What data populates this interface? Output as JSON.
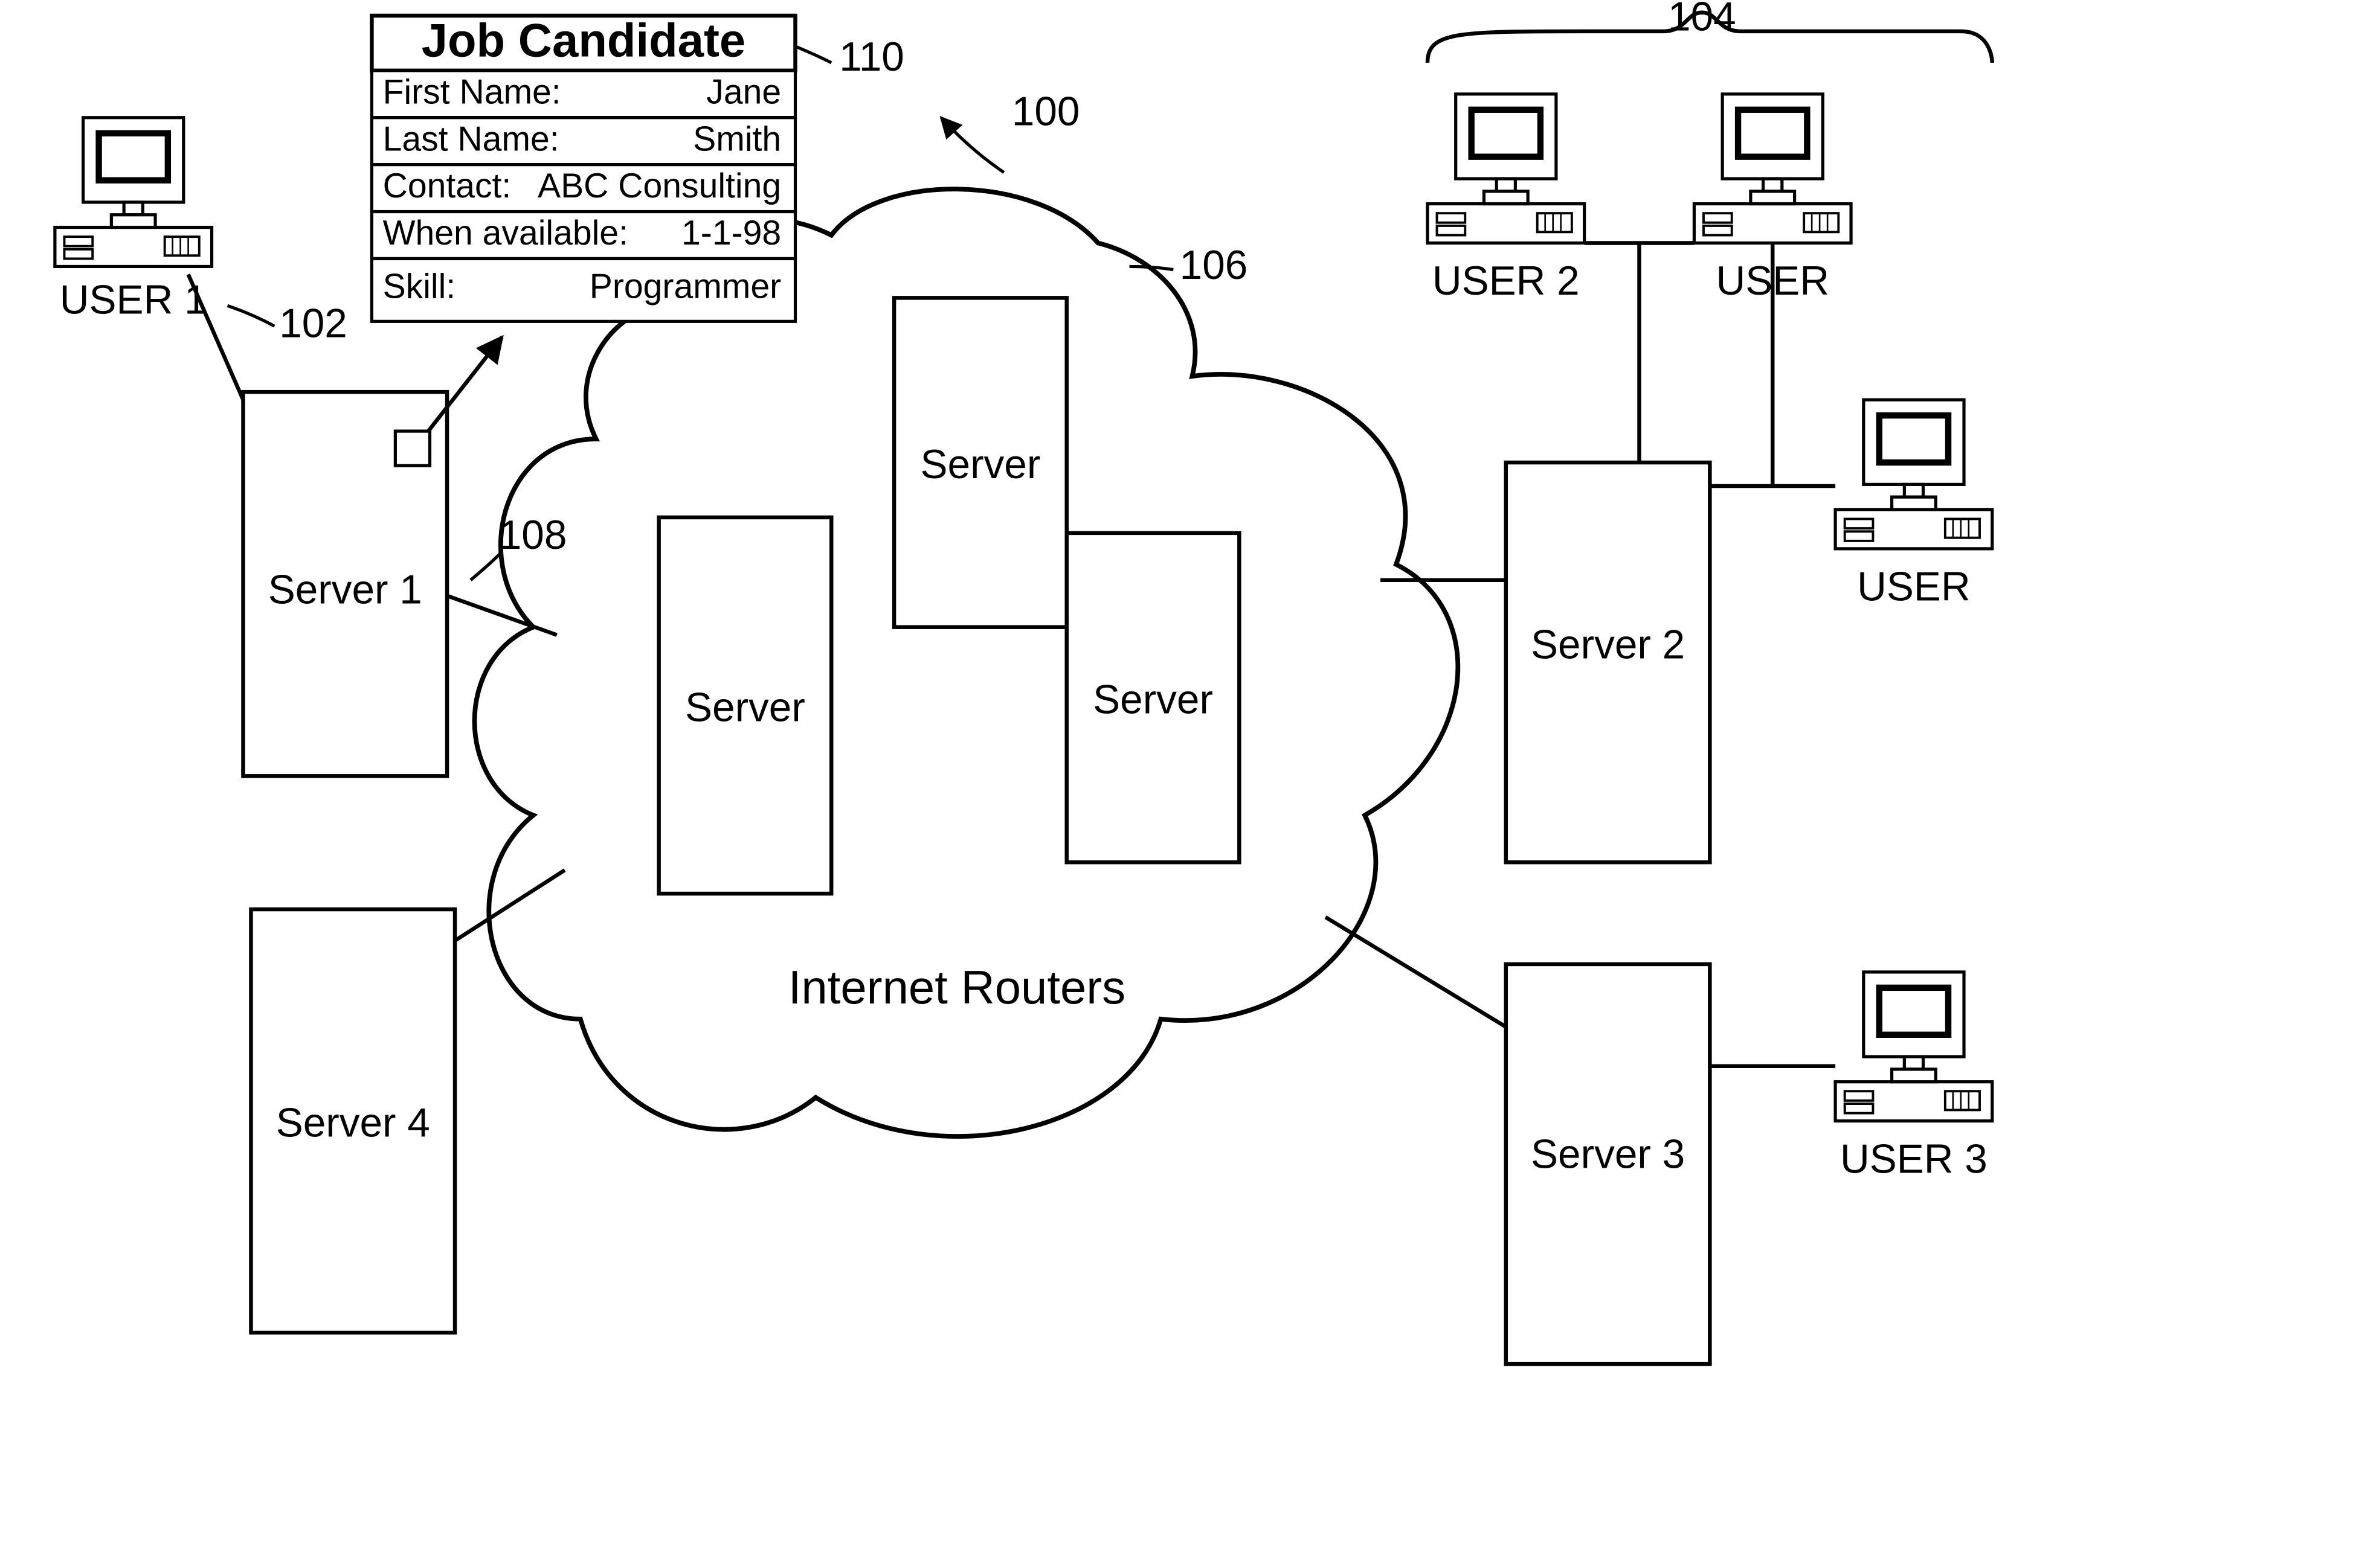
{
  "figure_refs": {
    "main": "100",
    "user1": "102",
    "user_group": "104",
    "cloud": "106",
    "link": "108",
    "card": "110"
  },
  "card": {
    "title": "Job Candidate",
    "rows": [
      {
        "label": "First Name:",
        "value": "Jane"
      },
      {
        "label": "Last Name:",
        "value": "Smith"
      },
      {
        "label": "Contact:",
        "value": "ABC Consulting"
      },
      {
        "label": "When available:",
        "value": "1-1-98"
      },
      {
        "label": "Skill:",
        "value": "Programmer"
      }
    ]
  },
  "cloud": {
    "label": "Internet Routers",
    "nodes": [
      "Server",
      "Server",
      "Server"
    ]
  },
  "servers": {
    "s1": "Server 1",
    "s2": "Server 2",
    "s3": "Server 3",
    "s4": "Server 4"
  },
  "users": {
    "u1": "USER 1",
    "u2": "USER 2",
    "u2b": "USER",
    "u2c": "USER",
    "u3": "USER 3"
  }
}
